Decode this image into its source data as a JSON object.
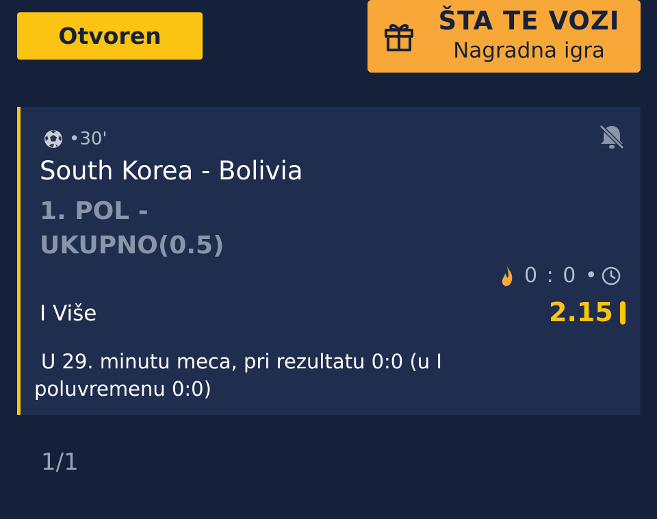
{
  "status": {
    "label": "Otvoren"
  },
  "promo": {
    "title": "ŠTA TE VOZI",
    "subtitle": "Nagradna igra",
    "icon": "gift-icon"
  },
  "ticket": {
    "sport_icon": "soccer-ball-icon",
    "minute": "•30'",
    "match": "South Korea - Bolivia",
    "market": "1. POL - UKUPNO(0.5)",
    "live_score": "0 : 0 •",
    "selection": "I Više",
    "odds": "2.15",
    "description": "U 29. minutu meca, pri rezultatu 0:0 (u I poluvremenu 0:0)",
    "notification_icon": "bell-off-icon"
  },
  "pagination": {
    "label": "1/1"
  },
  "colors": {
    "accent": "#fcc412",
    "promo": "#f7a838",
    "background": "#15203b",
    "card": "#1f2d4f"
  }
}
